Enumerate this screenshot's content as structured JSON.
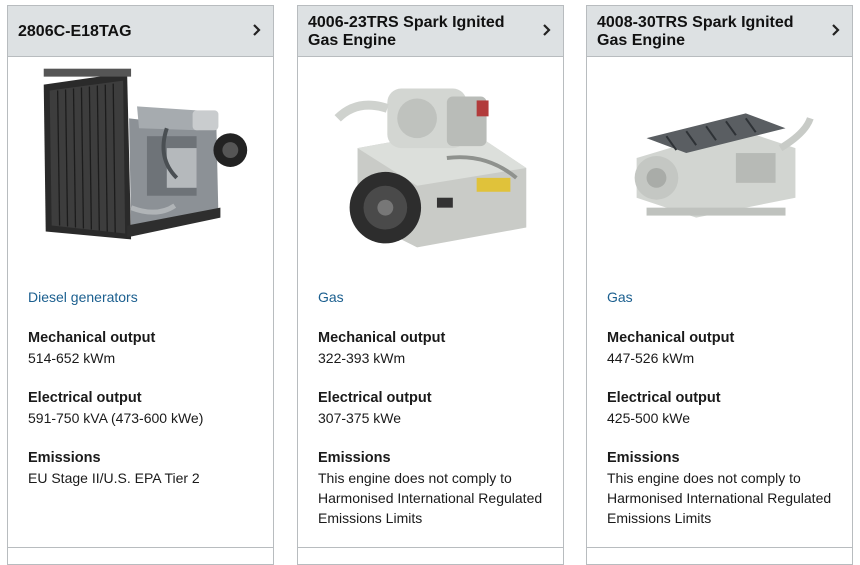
{
  "cards": [
    {
      "title": "2806C-E18TAG",
      "category": "Diesel generators",
      "mech_label": "Mechanical output",
      "mech_value": "514-652 kWm",
      "elec_label": "Electrical output",
      "elec_value": "591-750 kVA (473-600 kWe)",
      "emis_label": "Emissions",
      "emis_value": "EU Stage II/U.S. EPA Tier 2"
    },
    {
      "title": "4006-23TRS Spark Ignited Gas Engine",
      "category": "Gas",
      "mech_label": "Mechanical output",
      "mech_value": "322-393 kWm",
      "elec_label": "Electrical output",
      "elec_value": "307-375 kWe",
      "emis_label": "Emissions",
      "emis_value": "This engine does not comply to Harmonised International Regulated Emissions Limits"
    },
    {
      "title": "4008-30TRS Spark Ignited Gas Engine",
      "category": "Gas",
      "mech_label": "Mechanical output",
      "mech_value": "447-526 kWm",
      "elec_label": "Electrical output",
      "elec_value": "425-500 kWe",
      "emis_label": "Emissions",
      "emis_value": "This engine does not comply to Harmonised International Regulated Emissions Limits"
    }
  ],
  "icons": {
    "header_arrow": "chevron-right-icon"
  },
  "colors": {
    "header_bg": "#dde1e3",
    "link": "#1b5f8f",
    "border": "#b8bcbf"
  }
}
